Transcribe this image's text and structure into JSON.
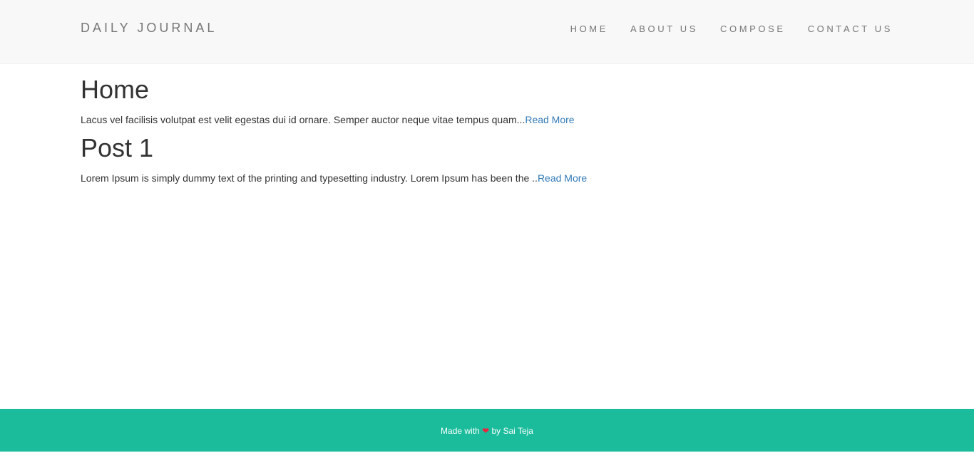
{
  "navbar": {
    "brand": "DAILY JOURNAL",
    "links": [
      {
        "label": "HOME"
      },
      {
        "label": "ABOUT US"
      },
      {
        "label": "COMPOSE"
      },
      {
        "label": "CONTACT US"
      }
    ]
  },
  "posts": [
    {
      "title": "Home",
      "excerpt": "Lacus vel facilisis volutpat est velit egestas dui id ornare. Semper auctor neque vitae tempus quam...",
      "read_more": "Read More"
    },
    {
      "title": "Post 1",
      "excerpt": "Lorem Ipsum is simply dummy text of the printing and typesetting industry. Lorem Ipsum has been the ..",
      "read_more": "Read More"
    }
  ],
  "footer": {
    "prefix": "Made with",
    "heart_icon": "heart-icon",
    "suffix": "by Sai Teja"
  },
  "colors": {
    "navbar_bg": "#f8f8f8",
    "footer_bg": "#1abc9c",
    "link": "#337ab7",
    "heart": "#e8253c"
  }
}
